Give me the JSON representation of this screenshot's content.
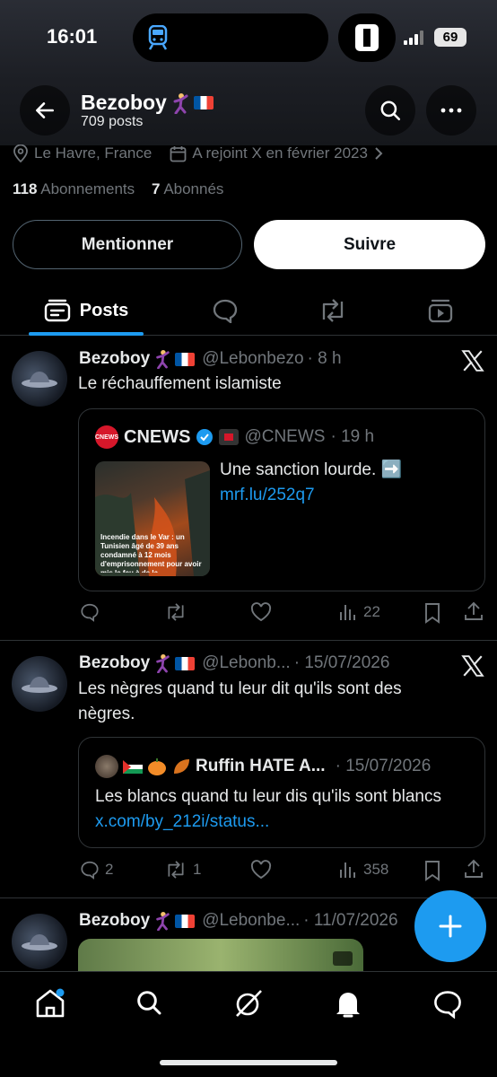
{
  "status": {
    "time": "16:01",
    "battery": "69"
  },
  "header": {
    "name": "Bezoboy",
    "posts_count": "709 posts"
  },
  "profile": {
    "location": "Le Havre, France",
    "joined": "A rejoint X en février 2023",
    "following_count": "118",
    "following_label": "Abonnements",
    "followers_count": "7",
    "followers_label": "Abonnés",
    "mention_button": "Mentionner",
    "follow_button": "Suivre"
  },
  "tabs": {
    "posts": "Posts"
  },
  "tweets": [
    {
      "name": "Bezoboy",
      "handle": "@Lebonbezo",
      "time": "· 8 h",
      "text": "Le réchauffement islamiste",
      "quote": {
        "name": "CNEWS",
        "handle": "@CNEWS",
        "time": "· 19 h",
        "text": "Une sanction lourde. ➡️",
        "link": "mrf.lu/252q7",
        "badge": "CNEWS",
        "thumb_caption": "Incendie dans le Var : un Tunisien âgé de 39 ans condamné à 12 mois d'emprisonnement pour avoir mis le feu à de la"
      },
      "views": "22"
    },
    {
      "name": "Bezoboy",
      "handle": "@Lebonb...",
      "time": "· 15/07/2026",
      "text": "Les nègres quand tu leur dit qu'ils sont des nègres.",
      "quote": {
        "name": "Ruffin HATE A...",
        "time": "· 15/07/2026",
        "text": "Les blancs quand tu leur dis qu'ils sont blancs",
        "link": "x.com/by_212i/status..."
      },
      "replies": "2",
      "reposts": "1",
      "views": "358"
    },
    {
      "name": "Bezoboy",
      "handle": "@Lebonbe...",
      "time": "· 11/07/2026"
    }
  ],
  "colors": {
    "accent": "#1d9bf0",
    "background": "#000000",
    "muted": "#71767b"
  }
}
